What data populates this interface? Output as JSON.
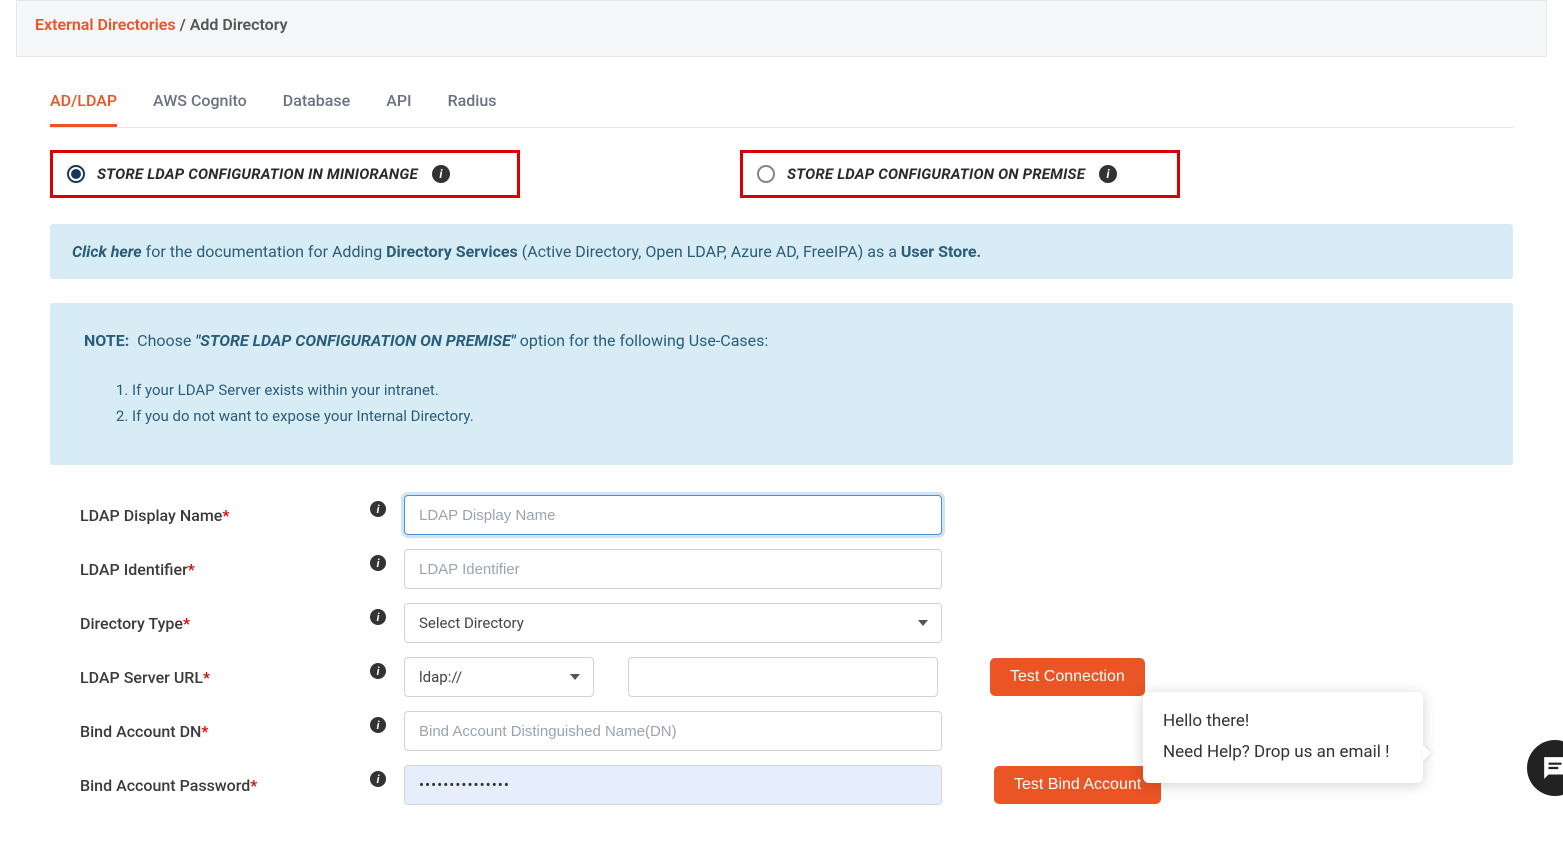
{
  "breadcrumb": {
    "root": "External Directories",
    "sep": "/",
    "current": "Add Directory"
  },
  "tabs": [
    "AD/LDAP",
    "AWS Cognito",
    "Database",
    "API",
    "Radius"
  ],
  "radio": {
    "opt1": "STORE LDAP CONFIGURATION IN MINIORANGE",
    "opt2": "STORE LDAP CONFIGURATION ON PREMISE"
  },
  "doc_banner": {
    "click": "Click here",
    "t1": " for the documentation for Adding ",
    "bold1": "Directory Services",
    "t2": " (Active Directory, Open LDAP, Azure AD, FreeIPA) as a ",
    "bold2": "User Store."
  },
  "note": {
    "label": "NOTE:",
    "choose": "Choose",
    "quoted": "\"STORE LDAP CONFIGURATION ON PREMISE\"",
    "after": " option for the following Use-Cases:",
    "items": [
      "If your LDAP Server exists within your intranet.",
      "If you do not want to expose your Internal Directory."
    ]
  },
  "fields": {
    "display_name": {
      "label": "LDAP Display Name",
      "placeholder": "LDAP Display Name",
      "value": ""
    },
    "identifier": {
      "label": "LDAP Identifier",
      "placeholder": "LDAP Identifier",
      "value": ""
    },
    "dir_type": {
      "label": "Directory Type",
      "selected": "Select Directory"
    },
    "server_url": {
      "label": "LDAP Server URL",
      "protocol": "ldap://",
      "value": ""
    },
    "bind_dn": {
      "label": "Bind Account DN",
      "placeholder": "Bind Account Distinguished Name(DN)",
      "value": ""
    },
    "bind_pwd": {
      "label": "Bind Account Password",
      "value": "•••••••••••••••"
    }
  },
  "buttons": {
    "test_conn": "Test Connection",
    "test_bind": "Test Bind Account"
  },
  "chat": {
    "line1": "Hello there!",
    "line2": "Need Help? Drop us an email !"
  }
}
